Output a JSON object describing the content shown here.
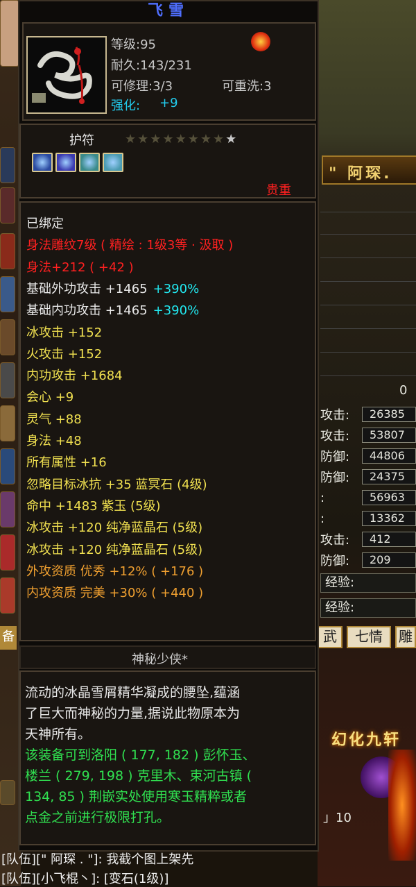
{
  "background": {
    "banner": "\" 阿琛.",
    "blank_value": "0",
    "stats": [
      {
        "label": "攻击:",
        "value": "26385"
      },
      {
        "label": "攻击:",
        "value": "53807"
      },
      {
        "label": "防御:",
        "value": "44806"
      },
      {
        "label": "防御:",
        "value": "24375"
      },
      {
        "label": ":",
        "value": "56963"
      },
      {
        "label": ":",
        "value": "13362"
      },
      {
        "label": "攻击:",
        "value": "412"
      },
      {
        "label": "防御:",
        "value": "209"
      }
    ],
    "exp_rows": [
      "经验:",
      "经验:"
    ],
    "tabs": [
      "武",
      "七情",
      "雕"
    ],
    "glow_text": "幻化九轩",
    "side_badge": "备",
    "counter": "」10",
    "chat": [
      "[队伍][\" 阿琛 . \"]: 我截个图上架先",
      "[队伍][小飞棍丶]: [变石(1级)]"
    ]
  },
  "tooltip": {
    "title": "飞雪",
    "level": "等级:95",
    "durability": "耐久:143/231",
    "repairable": "可修理:3/3",
    "rewashable": "可重洗:3",
    "enhance_label": "强化:",
    "enhance_value": "+9",
    "type": "护符",
    "stars_total": 9,
    "stars_lit": 1,
    "rarity": "贵重",
    "gem_colors": [
      "#2a4aa0",
      "#3a3ab0",
      "#3a8a8a",
      "#4a9ab0"
    ],
    "lines": [
      {
        "text": "已绑定",
        "color": "white"
      },
      {
        "text": "身法雕纹7级 ( 精绘 : 1级3等 · 汲取 )",
        "color": "red"
      },
      {
        "text": "身法+212 ( +42 )",
        "color": "red"
      },
      {
        "text": "基础外功攻击 +1465",
        "extra": "+390%",
        "color": "white"
      },
      {
        "text": "基础内功攻击 +1465",
        "extra": "+390%",
        "color": "white"
      },
      {
        "text": "冰攻击 +152",
        "color": "yellow"
      },
      {
        "text": "火攻击 +152",
        "color": "yellow"
      },
      {
        "text": "内功攻击 +1684",
        "color": "yellow"
      },
      {
        "text": "会心 +9",
        "color": "yellow"
      },
      {
        "text": "灵气 +88",
        "color": "yellow"
      },
      {
        "text": "身法 +48",
        "color": "yellow"
      },
      {
        "text": "所有属性 +16",
        "color": "yellow"
      },
      {
        "text": "忽略目标冰抗 +35 蓝冥石 (4级)",
        "color": "yellow"
      },
      {
        "text": "命中 +1483 紫玉 (5级)",
        "color": "yellow"
      },
      {
        "text": "冰攻击 +120 纯净蓝晶石 (5级)",
        "color": "yellow"
      },
      {
        "text": "冰攻击 +120 纯净蓝晶石 (5级)",
        "color": "yellow"
      },
      {
        "text": "外攻资质  优秀 +12% ( +176 )",
        "color": "orange"
      },
      {
        "text": "内攻资质  完美 +30% ( +440 )",
        "color": "orange"
      }
    ],
    "maker": "神秘少侠*",
    "description": [
      "流动的冰晶雪屑精华凝成的腰坠,蕴涵",
      "了巨大而神秘的力量,据说此物原本为",
      "天神所有。"
    ],
    "hint": [
      "该装备可到洛阳 ( 177, 182 ) 彭怀玉、",
      "楼兰 ( 279, 198 ) 克里木、束河古镇 (",
      "134, 85 ) 荆嵌实处使用寒玉精粹或者",
      "点金之前进行极限打孔。"
    ]
  }
}
